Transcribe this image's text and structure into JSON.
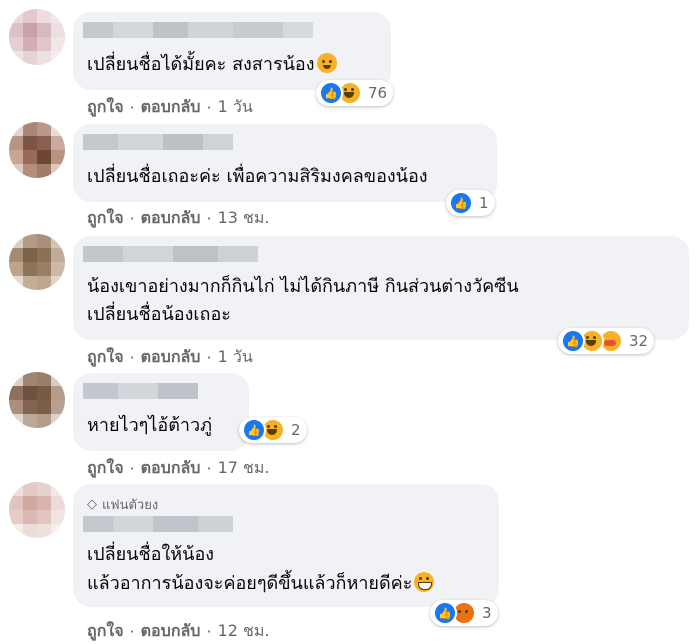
{
  "actions": {
    "like": "ถูกใจ",
    "reply": "ตอบกลับ",
    "sep": "·"
  },
  "comments": [
    {
      "line1": "เปลี่ยนชื่อได้มั้ยคะ สงสารน้อง",
      "time": "1 วัน",
      "reaction_count": "76"
    },
    {
      "line1": "เปลี่ยนชื่อเถอะค่ะ เพื่อความสิริมงคลของน้อง",
      "time": "13 ชม.",
      "reaction_count": "1"
    },
    {
      "line1": "น้องเขาอย่างมากก็กินไก่ ไม่ได้กินภาษี กินส่วนต่างวัคซีน",
      "line2": "เปลี่ยนชื่อน้องเถอะ",
      "time": "1 วัน",
      "reaction_count": "32"
    },
    {
      "line1": "หายไวๆไอ้ต้าวภู่",
      "time": "17 ชม.",
      "reaction_count": "2"
    },
    {
      "badge": "แฟนตัวยง",
      "line1": "เปลี่ยนชื่อให้น้อง",
      "line2": "แล้วอาการน้องจะค่อยๆดีขึ้นแล้วก็หายดีค่ะ",
      "time": "12 ชม.",
      "reaction_count": "3"
    }
  ],
  "colors": {
    "bubble": "#f0f2f5",
    "meta": "#65676b",
    "like": "#1877f2",
    "haha": "#f7b125"
  }
}
